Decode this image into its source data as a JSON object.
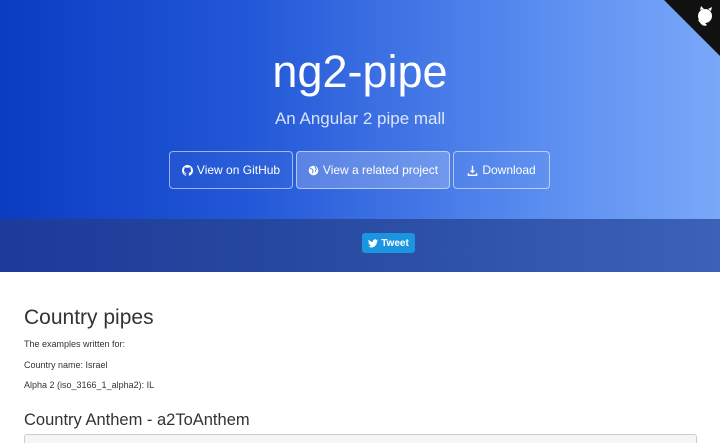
{
  "hero": {
    "title": "ng2-pipe",
    "subtitle": "An Angular 2 pipe mall",
    "buttons": [
      {
        "label": "View on GitHub",
        "icon": "github-icon"
      },
      {
        "label": "View a related project",
        "icon": "globe-icon"
      },
      {
        "label": "Download",
        "icon": "download-icon"
      }
    ],
    "tweet_label": "Tweet",
    "colors": {
      "gradient_start": "#0a3cc2",
      "gradient_end": "#7aa8f8",
      "tweet": "#1b95e0"
    }
  },
  "content": {
    "section_title": "Country pipes",
    "intro": "The examples written for:",
    "country_name": "Country name: Israel",
    "alpha2": "Alpha 2 (iso_3166_1_alpha2): IL",
    "subsection_title": "Country Anthem - a2ToAnthem"
  }
}
